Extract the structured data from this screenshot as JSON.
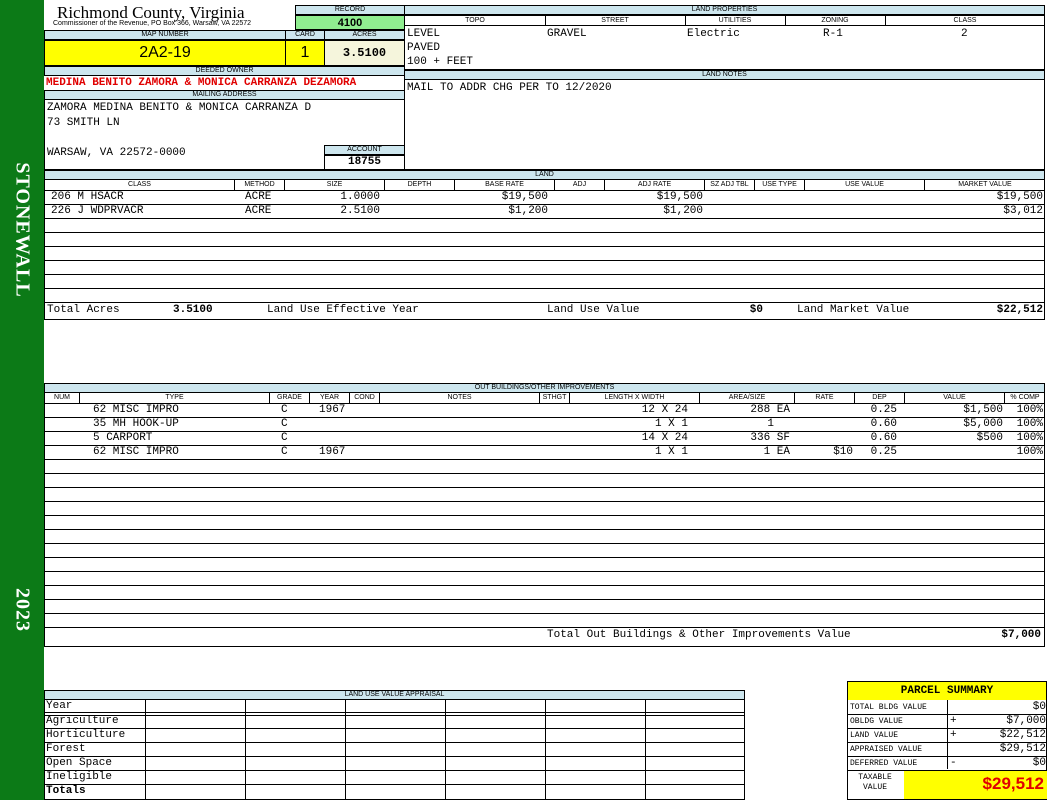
{
  "sidebar": {
    "district": "STONEWALL",
    "year": "2023"
  },
  "header": {
    "county": "Richmond County, Virginia",
    "subtitle": "Commissioner of the Revenue, PO Box 366, Warsaw, VA 22572",
    "record_label": "RECORD",
    "record_value": "4100",
    "map_label": "MAP NUMBER",
    "map_value": "2A2-19",
    "card_label": "CARD",
    "card_value": "1",
    "acres_label": "ACRES",
    "acres_value": "3.5100"
  },
  "owner": {
    "deeded_label": "DEEDED OWNER",
    "deeded_name": "MEDINA BENITO ZAMORA & MONICA CARRANZA DEZAMORA",
    "mailing_label": "MAILING ADDRESS",
    "mailing_lines": [
      "ZAMORA MEDINA BENITO & MONICA CARRANZA D",
      "73 SMITH LN",
      "",
      "WARSAW, VA 22572-0000"
    ],
    "account_label": "ACCOUNT",
    "account_value": "18755"
  },
  "land_properties": {
    "title": "LAND PROPERTIES",
    "headers": [
      "TOPO",
      "STREET",
      "UTILITIES",
      "ZONING",
      "CLASS"
    ],
    "topo": [
      "LEVEL",
      "PAVED",
      "100 + FEET"
    ],
    "street": "GRAVEL",
    "utilities": "Electric",
    "zoning": "R-1",
    "class": "2"
  },
  "land_notes": {
    "title": "LAND NOTES",
    "text": "MAIL TO ADDR CHG PER TO 12/2020"
  },
  "land": {
    "title": "LAND",
    "headers": [
      "CLASS",
      "METHOD",
      "SIZE",
      "DEPTH",
      "BASE RATE",
      "ADJ",
      "ADJ RATE",
      "SZ ADJ TBL",
      "USE TYPE",
      "USE VALUE",
      "MARKET VALUE"
    ],
    "rows": [
      {
        "class": "206 M HSACR",
        "method": "ACRE",
        "size": "1.0000",
        "depth": "",
        "base_rate": "$19,500",
        "adj": "",
        "adj_rate": "$19,500",
        "use_value": "",
        "market_value": "$19,500"
      },
      {
        "class": "226 J WDPRVACR",
        "method": "ACRE",
        "size": "2.5100",
        "depth": "",
        "base_rate": "$1,200",
        "adj": "",
        "adj_rate": "$1,200",
        "use_value": "",
        "market_value": "$3,012"
      }
    ],
    "totals": {
      "total_acres_label": "Total Acres",
      "total_acres": "3.5100",
      "effective_year_label": "Land Use Effective Year",
      "use_value_label": "Land Use Value",
      "use_value": "$0",
      "market_value_label": "Land Market Value",
      "market_value": "$22,512"
    }
  },
  "outbuildings": {
    "title": "OUT BUILDINGS/OTHER IMPROVEMENTS",
    "headers": [
      "NUM",
      "TYPE",
      "GRADE",
      "YEAR",
      "COND",
      "NOTES",
      "STHGT",
      "LENGTH X WIDTH",
      "AREA/SIZE",
      "RATE",
      "DEP",
      "VALUE",
      "% COMP"
    ],
    "rows": [
      {
        "type": "62 MISC IMPRO",
        "grade": "C",
        "year": "1967",
        "lxw": "12 X 24",
        "area": "288 EA",
        "rate": "",
        "dep": "0.25",
        "value": "$1,500",
        "comp": "100%"
      },
      {
        "type": "35 MH HOOK-UP",
        "grade": "C",
        "year": "",
        "lxw": "1 X 1",
        "area": "1",
        "rate": "",
        "dep": "0.60",
        "value": "$5,000",
        "comp": "100%"
      },
      {
        "type": "5 CARPORT",
        "grade": "C",
        "year": "",
        "lxw": "14 X 24",
        "area": "336 SF",
        "rate": "",
        "dep": "0.60",
        "value": "$500",
        "comp": "100%"
      },
      {
        "type": "62 MISC IMPRO",
        "grade": "C",
        "year": "1967",
        "lxw": "1 X 1",
        "area": "1 EA",
        "rate": "$10",
        "dep": "0.25",
        "value": "",
        "comp": "100%"
      }
    ],
    "total_label": "Total Out Buildings & Other Improvements Value",
    "total_value": "$7,000"
  },
  "land_use": {
    "title": "LAND USE VALUE APPRAISAL",
    "rows": [
      "Year",
      "Agriculture",
      "Horticulture",
      "Forest",
      "Open Space",
      "Ineligible",
      "Totals"
    ]
  },
  "summary": {
    "title": "PARCEL SUMMARY",
    "rows": [
      {
        "label": "TOTAL BLDG VALUE",
        "op": "",
        "value": "$0"
      },
      {
        "label": "OBLDG VALUE",
        "op": "+",
        "value": "$7,000"
      },
      {
        "label": "LAND VALUE",
        "op": "+",
        "value": "$22,512"
      },
      {
        "label": "APPRAISED VALUE",
        "op": "",
        "value": "$29,512"
      },
      {
        "label": "DEFERRED VALUE",
        "op": "-",
        "value": "$0"
      }
    ],
    "taxable_label": "TAXABLE VALUE",
    "taxable_value": "$29,512"
  }
}
